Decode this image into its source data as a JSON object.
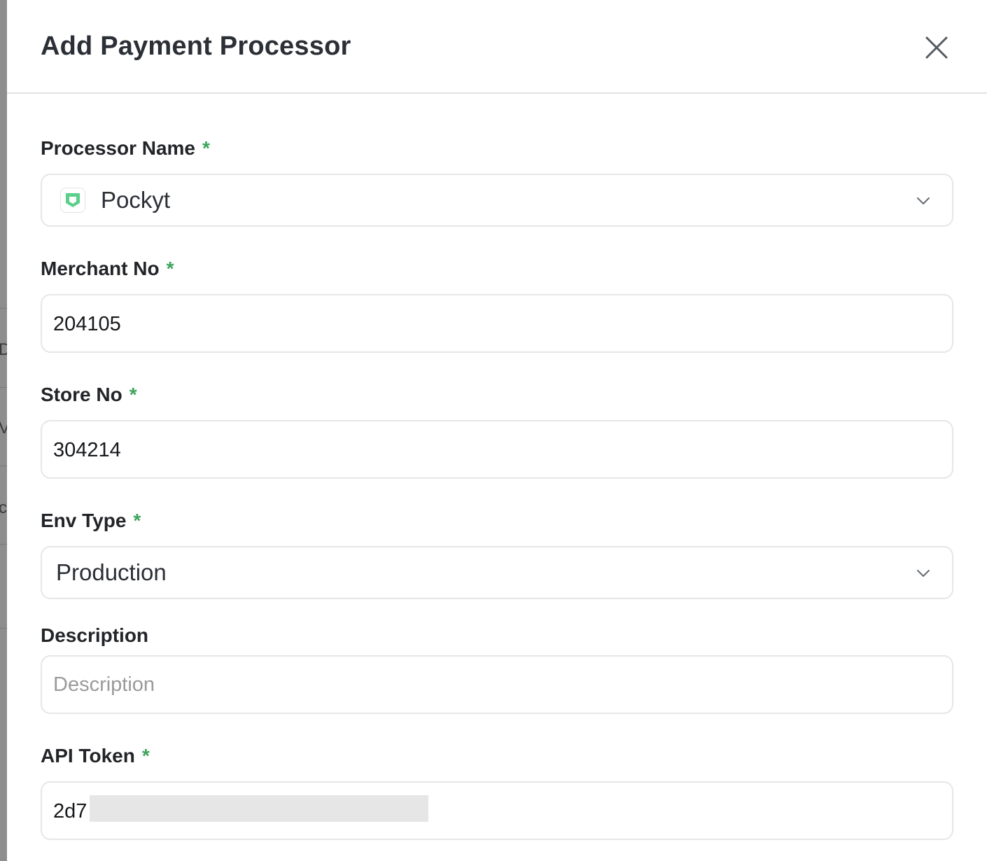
{
  "modal": {
    "title": "Add Payment Processor",
    "close_icon": "close-icon"
  },
  "required_marker": "*",
  "fields": {
    "processor_name": {
      "label": "Processor Name",
      "value": "Pockyt",
      "logo_icon": "pockyt-logo-icon",
      "dropdown_icon": "chevron-down-icon"
    },
    "merchant_no": {
      "label": "Merchant No",
      "value": "204105"
    },
    "store_no": {
      "label": "Store No",
      "value": "304214"
    },
    "env_type": {
      "label": "Env Type",
      "value": "Production",
      "dropdown_icon": "chevron-down-icon"
    },
    "description": {
      "label": "Description",
      "value": "",
      "placeholder": "Description"
    },
    "api_token": {
      "label": "API Token",
      "value_visible": "2d7"
    }
  },
  "colors": {
    "required": "#3da55d",
    "logo_green": "#5ccf8a",
    "border": "#e6e6e6",
    "placeholder": "#9a9a9a"
  }
}
